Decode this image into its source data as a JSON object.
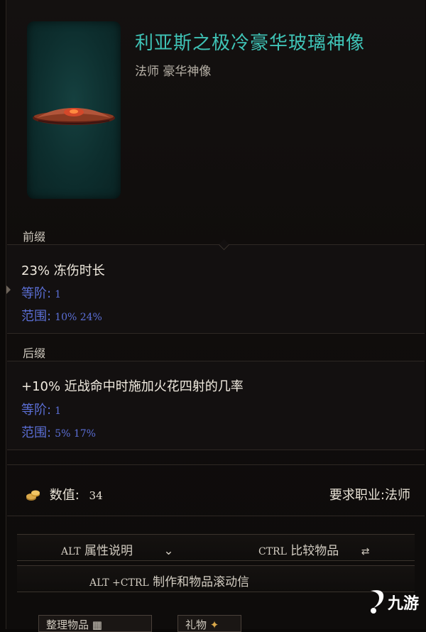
{
  "item": {
    "name": "利亚斯之极冷豪华玻璃神像",
    "subtitle": "法师 豪华神像"
  },
  "prefix": {
    "label": "前缀",
    "effect": "23% 冻伤时长",
    "tier_key": "等阶:",
    "tier_val": "1",
    "range_key": "范围:",
    "range_val": "10%  24%"
  },
  "suffix": {
    "label": "后缀",
    "effect": "+10% 近战命中时施加火花四射的几率",
    "tier_key": "等阶:",
    "tier_val": "1",
    "range_key": "范围:",
    "range_val": "5%  17%"
  },
  "footer": {
    "value_label": "数值:",
    "value": "34",
    "requirement": "要求职业:法师"
  },
  "controls": {
    "alt_key": "ALT",
    "alt_label": "属性说明",
    "ctrl_key": "CTRL",
    "ctrl_label": "比较物品",
    "altctrl_key": "ALT +CTRL",
    "altctrl_label": "制作和物品滚动信"
  },
  "buttons": {
    "sort_label": "整理物品",
    "gift_label": "礼物"
  },
  "watermark": {
    "text": "九游"
  }
}
